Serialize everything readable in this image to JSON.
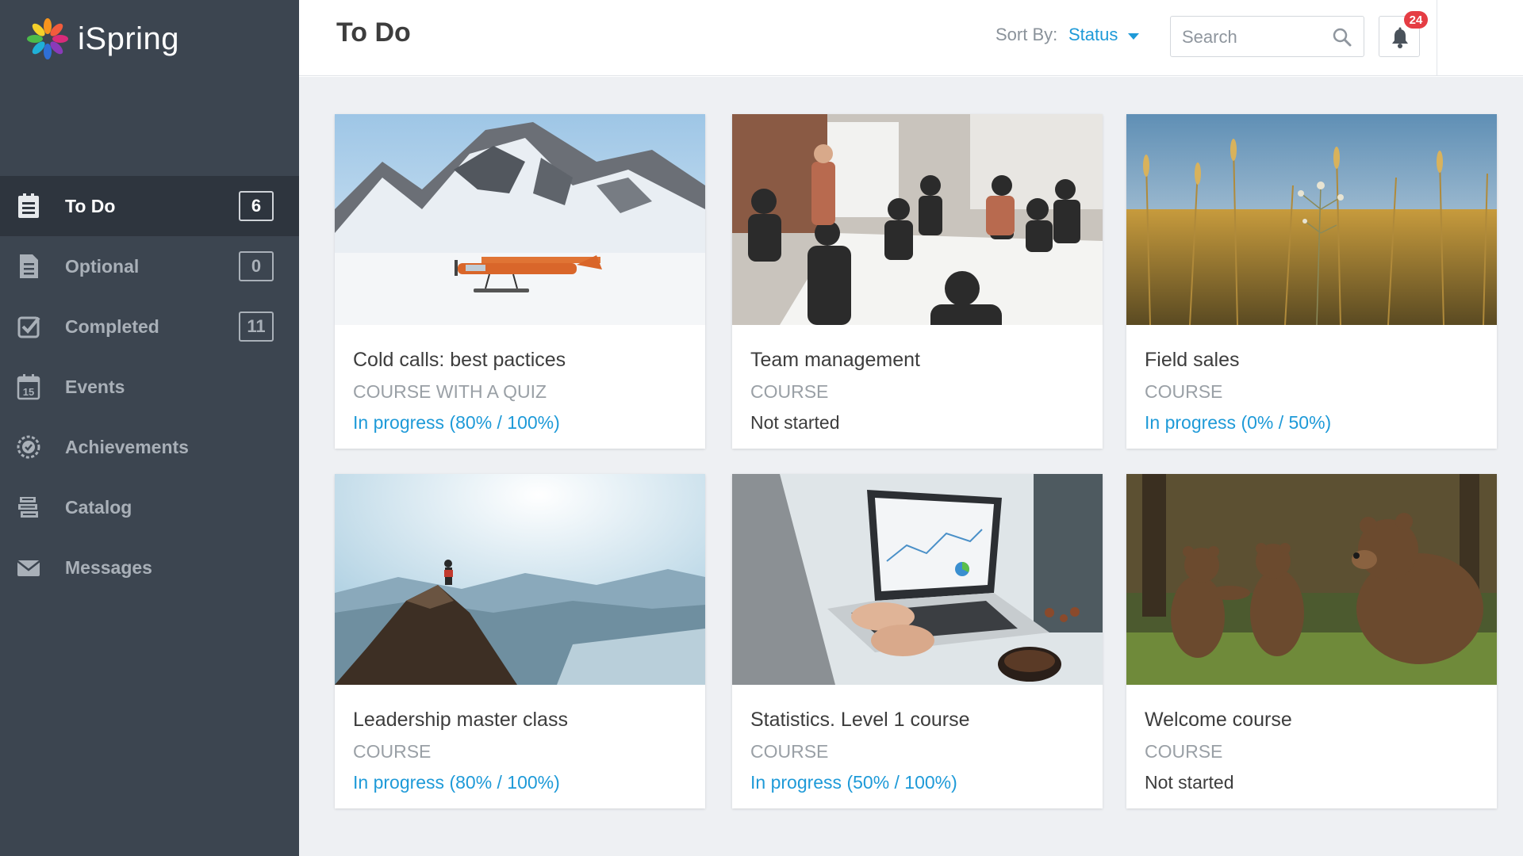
{
  "app": {
    "logo_text": "iSpring"
  },
  "sidebar": {
    "items": [
      {
        "label": "To Do",
        "count": "6",
        "icon": "todo-list-icon",
        "active": true
      },
      {
        "label": "Optional",
        "count": "0",
        "icon": "document-icon"
      },
      {
        "label": "Completed",
        "count": "11",
        "icon": "checkbox-icon"
      },
      {
        "label": "Events",
        "count": null,
        "icon": "calendar-icon",
        "icon_text": "15"
      },
      {
        "label": "Achievements",
        "count": null,
        "icon": "badge-icon"
      },
      {
        "label": "Catalog",
        "count": null,
        "icon": "books-icon"
      },
      {
        "label": "Messages",
        "count": null,
        "icon": "envelope-icon"
      }
    ]
  },
  "header": {
    "title": "To Do",
    "sort_label": "Sort By:",
    "sort_value": "Status",
    "search_placeholder": "Search",
    "notifications_count": "24"
  },
  "cards": [
    {
      "title": "Cold calls: best pactices",
      "type": "COURSE WITH A QUIZ",
      "status": "In progress (80% / 100%)",
      "status_kind": "progress",
      "image": "snowy-mountain-plane"
    },
    {
      "title": "Team management",
      "type": "COURSE",
      "status": "Not started",
      "status_kind": "not-started",
      "image": "office-meeting"
    },
    {
      "title": "Field sales",
      "type": "COURSE",
      "status": "In progress (0% / 50%)",
      "status_kind": "progress",
      "image": "wheat-field"
    },
    {
      "title": "Leadership master class",
      "type": "COURSE",
      "status": "In progress (80% / 100%)",
      "status_kind": "progress",
      "image": "mountain-summit"
    },
    {
      "title": "Statistics. Level 1 course",
      "type": "COURSE",
      "status": "In progress (50% / 100%)",
      "status_kind": "progress",
      "image": "laptop-typing"
    },
    {
      "title": "Welcome course",
      "type": "COURSE",
      "status": "Not started",
      "status_kind": "not-started",
      "image": "bears"
    }
  ],
  "colors": {
    "sidebar_bg": "#3c4550",
    "sidebar_active_bg": "#2e353e",
    "accent": "#1e9ad8",
    "badge": "#e53d44",
    "main_bg": "#eef0f3"
  }
}
